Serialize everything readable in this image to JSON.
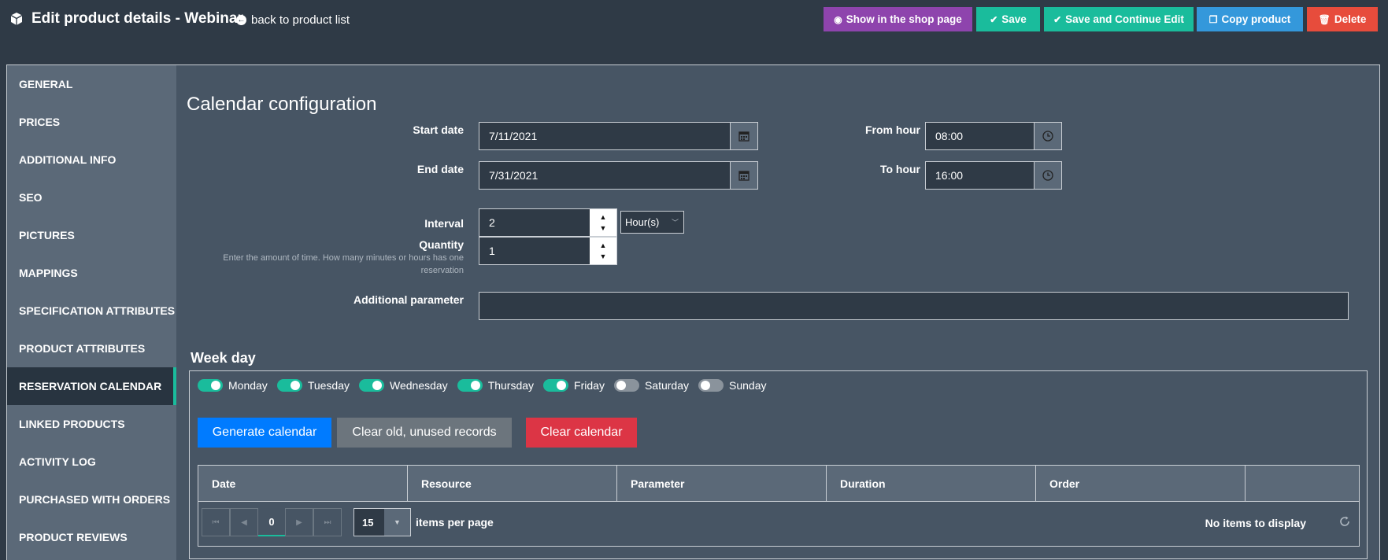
{
  "header": {
    "title": "Edit product details - Webinar",
    "back_label": "back to product list",
    "buttons": {
      "shop": "Show in the shop page",
      "save": "Save",
      "save_continue": "Save and Continue Edit",
      "copy": "Copy product",
      "delete": "Delete"
    }
  },
  "sidebar": {
    "items": [
      {
        "label": "GENERAL"
      },
      {
        "label": "PRICES"
      },
      {
        "label": "ADDITIONAL INFO"
      },
      {
        "label": "SEO"
      },
      {
        "label": "PICTURES"
      },
      {
        "label": "MAPPINGS"
      },
      {
        "label": "SPECIFICATION ATTRIBUTES"
      },
      {
        "label": "PRODUCT ATTRIBUTES"
      },
      {
        "label": "RESERVATION CALENDAR"
      },
      {
        "label": "LINKED PRODUCTS"
      },
      {
        "label": "ACTIVITY LOG"
      },
      {
        "label": "PURCHASED WITH ORDERS"
      },
      {
        "label": "PRODUCT REVIEWS"
      }
    ],
    "active": "RESERVATION CALENDAR"
  },
  "calendar": {
    "title": "Calendar configuration",
    "start_date_label": "Start date",
    "start_date": "7/11/2021",
    "end_date_label": "End date",
    "end_date": "7/31/2021",
    "from_hour_label": "From hour",
    "from_hour": "08:00",
    "to_hour_label": "To hour",
    "to_hour": "16:00",
    "interval_label": "Interval",
    "interval": "2",
    "interval_unit": "Hour(s)",
    "quantity_label": "Quantity",
    "quantity": "1",
    "hint": "Enter the amount of time. How many minutes or hours has one reservation",
    "additional_label": "Additional parameter",
    "additional_value": ""
  },
  "weekday": {
    "title": "Week day",
    "days": [
      {
        "label": "Monday",
        "on": true
      },
      {
        "label": "Tuesday",
        "on": true
      },
      {
        "label": "Wednesday",
        "on": true
      },
      {
        "label": "Thursday",
        "on": true
      },
      {
        "label": "Friday",
        "on": true
      },
      {
        "label": "Saturday",
        "on": false
      },
      {
        "label": "Sunday",
        "on": false
      }
    ],
    "buttons": {
      "generate": "Generate calendar",
      "clear_old": "Clear old, unused records",
      "clear_calendar": "Clear calendar"
    }
  },
  "grid": {
    "columns": [
      "Date",
      "Resource",
      "Parameter",
      "Duration",
      "Order",
      ""
    ],
    "page": "0",
    "page_size": "15",
    "items_per_page": "items per page",
    "empty": "No items to display"
  },
  "colors": {
    "background": "#2f3a46",
    "panel": "#475564",
    "sidebar": "#5b6978",
    "accent": "#1abc9c",
    "purple": "#8e44ad",
    "blue": "#3498db",
    "red": "#e74c3c"
  }
}
